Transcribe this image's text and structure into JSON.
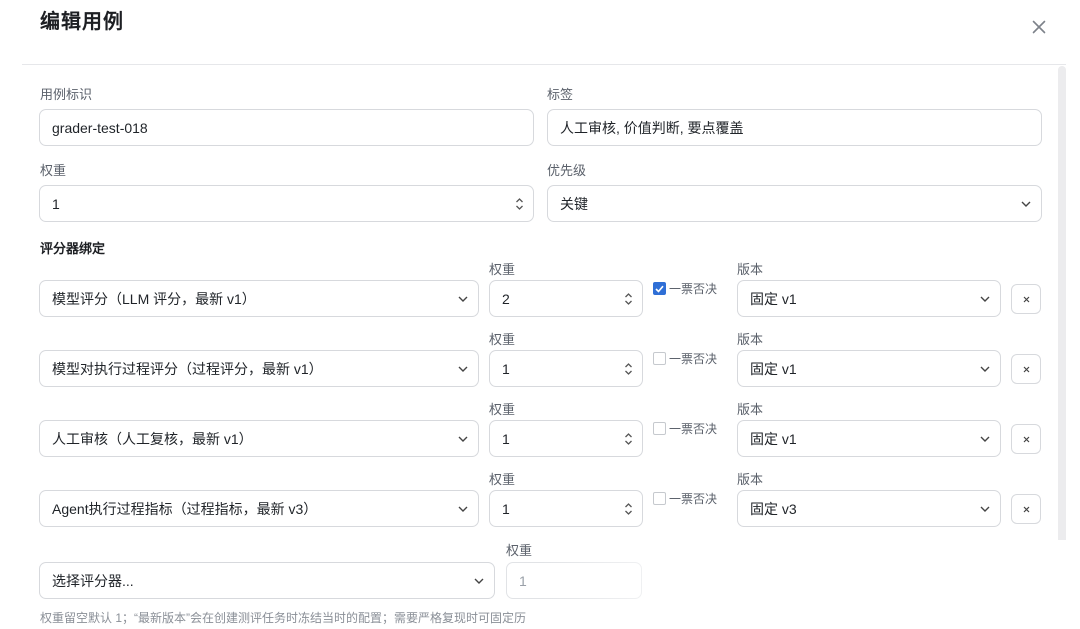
{
  "dialog": {
    "title": "编辑用例",
    "close_label": "×"
  },
  "form": {
    "case_id": {
      "label": "用例标识",
      "value": "grader-test-018"
    },
    "tags": {
      "label": "标签",
      "value": "人工审核, 价值判断, 要点覆盖"
    },
    "weight": {
      "label": "权重",
      "value": "1"
    },
    "priority": {
      "label": "优先级",
      "value": "关键"
    }
  },
  "graders": {
    "section_title": "评分器绑定",
    "weight_label": "权重",
    "version_label": "版本",
    "veto_label": "一票否决",
    "remove_label": "×",
    "rows": [
      {
        "grader": "模型评分（LLM 评分，最新 v1）",
        "weight": "2",
        "veto": true,
        "version": "固定 v1"
      },
      {
        "grader": "模型对执行过程评分（过程评分，最新 v1）",
        "weight": "1",
        "veto": false,
        "version": "固定 v1"
      },
      {
        "grader": "人工审核（人工复核，最新 v1）",
        "weight": "1",
        "veto": false,
        "version": "固定 v1"
      },
      {
        "grader": "Agent执行过程指标（过程指标，最新 v3）",
        "weight": "1",
        "veto": false,
        "version": "固定 v3"
      }
    ],
    "new_row": {
      "placeholder": "选择评分器...",
      "weight": "1"
    }
  },
  "hint": "权重留空默认 1；“最新版本”会在创建测评任务时冻结当时的配置；需要严格复现时可固定历"
}
